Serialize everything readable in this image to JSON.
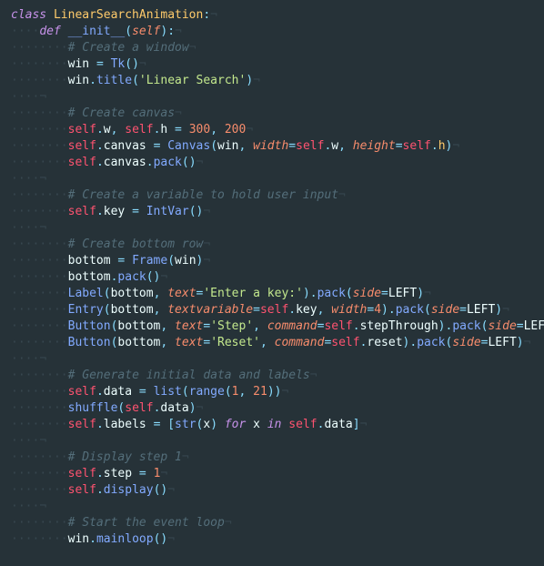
{
  "ws4": "····",
  "ws8": "········",
  "eol": "¬",
  "lines": [
    {
      "t": [
        [
          "kw",
          "class"
        ],
        [
          "id",
          " "
        ],
        [
          "cl",
          "LinearSearchAnimation"
        ],
        [
          "p",
          ":"
        ]
      ]
    },
    {
      "i": 1,
      "t": [
        [
          "kw",
          "def"
        ],
        [
          "id",
          " "
        ],
        [
          "fn",
          "__init__"
        ],
        [
          "p",
          "("
        ],
        [
          "pn",
          "self"
        ],
        [
          "p",
          ")"
        ],
        [
          "p",
          ":"
        ]
      ]
    },
    {
      "i": 2,
      "t": [
        [
          "c",
          "# Create a window"
        ]
      ]
    },
    {
      "i": 2,
      "t": [
        [
          "id",
          "win "
        ],
        [
          "o",
          "="
        ],
        [
          "id",
          " "
        ],
        [
          "pr",
          "Tk"
        ],
        [
          "p",
          "()"
        ]
      ]
    },
    {
      "i": 2,
      "t": [
        [
          "id",
          "win"
        ],
        [
          "p",
          "."
        ],
        [
          "fn",
          "title"
        ],
        [
          "p",
          "("
        ],
        [
          "s",
          "'Linear Search'"
        ],
        [
          "p",
          ")"
        ]
      ]
    },
    {
      "blank": 1
    },
    {
      "i": 2,
      "t": [
        [
          "c",
          "# Create canvas"
        ]
      ]
    },
    {
      "i": 2,
      "t": [
        [
          "sf",
          "self"
        ],
        [
          "p",
          "."
        ],
        [
          "id",
          "w"
        ],
        [
          "p",
          ","
        ],
        [
          "id",
          " "
        ],
        [
          "sf",
          "self"
        ],
        [
          "p",
          "."
        ],
        [
          "id",
          "h "
        ],
        [
          "o",
          "="
        ],
        [
          "id",
          " "
        ],
        [
          "n",
          "300"
        ],
        [
          "p",
          ","
        ],
        [
          "id",
          " "
        ],
        [
          "n",
          "200"
        ]
      ]
    },
    {
      "i": 2,
      "t": [
        [
          "sf",
          "self"
        ],
        [
          "p",
          "."
        ],
        [
          "id",
          "canvas "
        ],
        [
          "o",
          "="
        ],
        [
          "id",
          " "
        ],
        [
          "pr",
          "Canvas"
        ],
        [
          "p",
          "("
        ],
        [
          "id",
          "win"
        ],
        [
          "p",
          ","
        ],
        [
          "id",
          " "
        ],
        [
          "pn",
          "width"
        ],
        [
          "o",
          "="
        ],
        [
          "sf",
          "self"
        ],
        [
          "p",
          "."
        ],
        [
          "id",
          "w"
        ],
        [
          "p",
          ","
        ],
        [
          "id",
          " "
        ],
        [
          "pn",
          "height"
        ],
        [
          "o",
          "="
        ],
        [
          "sf",
          "self"
        ],
        [
          "p",
          "."
        ],
        [
          "mf",
          "h"
        ],
        [
          "p",
          ")"
        ]
      ]
    },
    {
      "i": 2,
      "t": [
        [
          "sf",
          "self"
        ],
        [
          "p",
          "."
        ],
        [
          "id",
          "canvas"
        ],
        [
          "p",
          "."
        ],
        [
          "fn",
          "pack"
        ],
        [
          "p",
          "()"
        ]
      ]
    },
    {
      "blank": 1
    },
    {
      "i": 2,
      "t": [
        [
          "c",
          "# Create a variable to hold user input"
        ]
      ]
    },
    {
      "i": 2,
      "t": [
        [
          "sf",
          "self"
        ],
        [
          "p",
          "."
        ],
        [
          "id",
          "key "
        ],
        [
          "o",
          "="
        ],
        [
          "id",
          " "
        ],
        [
          "pr",
          "IntVar"
        ],
        [
          "p",
          "()"
        ]
      ]
    },
    {
      "blank": 1
    },
    {
      "i": 2,
      "t": [
        [
          "c",
          "# Create bottom row"
        ]
      ]
    },
    {
      "i": 2,
      "t": [
        [
          "id",
          "bottom "
        ],
        [
          "o",
          "="
        ],
        [
          "id",
          " "
        ],
        [
          "pr",
          "Frame"
        ],
        [
          "p",
          "("
        ],
        [
          "id",
          "win"
        ],
        [
          "p",
          ")"
        ]
      ]
    },
    {
      "i": 2,
      "t": [
        [
          "id",
          "bottom"
        ],
        [
          "p",
          "."
        ],
        [
          "fn",
          "pack"
        ],
        [
          "p",
          "()"
        ]
      ]
    },
    {
      "i": 2,
      "t": [
        [
          "pr",
          "Label"
        ],
        [
          "p",
          "("
        ],
        [
          "id",
          "bottom"
        ],
        [
          "p",
          ","
        ],
        [
          "id",
          " "
        ],
        [
          "pn",
          "text"
        ],
        [
          "o",
          "="
        ],
        [
          "s",
          "'Enter a key:'"
        ],
        [
          "p",
          ")."
        ],
        [
          "fn",
          "pack"
        ],
        [
          "p",
          "("
        ],
        [
          "pn",
          "side"
        ],
        [
          "o",
          "="
        ],
        [
          "id",
          "LEFT"
        ],
        [
          "p",
          ")"
        ]
      ]
    },
    {
      "i": 2,
      "t": [
        [
          "pr",
          "Entry"
        ],
        [
          "p",
          "("
        ],
        [
          "id",
          "bottom"
        ],
        [
          "p",
          ","
        ],
        [
          "id",
          " "
        ],
        [
          "pn",
          "textvariable"
        ],
        [
          "o",
          "="
        ],
        [
          "sf",
          "self"
        ],
        [
          "p",
          "."
        ],
        [
          "id",
          "key"
        ],
        [
          "p",
          ","
        ],
        [
          "id",
          " "
        ],
        [
          "pn",
          "width"
        ],
        [
          "o",
          "="
        ],
        [
          "n",
          "4"
        ],
        [
          "p",
          ")."
        ],
        [
          "fn",
          "pack"
        ],
        [
          "p",
          "("
        ],
        [
          "pn",
          "side"
        ],
        [
          "o",
          "="
        ],
        [
          "id",
          "LEFT"
        ],
        [
          "p",
          ")"
        ]
      ]
    },
    {
      "i": 2,
      "t": [
        [
          "pr",
          "Button"
        ],
        [
          "p",
          "("
        ],
        [
          "id",
          "bottom"
        ],
        [
          "p",
          ","
        ],
        [
          "id",
          " "
        ],
        [
          "pn",
          "text"
        ],
        [
          "o",
          "="
        ],
        [
          "s",
          "'Step'"
        ],
        [
          "p",
          ","
        ],
        [
          "id",
          " "
        ],
        [
          "pn",
          "command"
        ],
        [
          "o",
          "="
        ],
        [
          "sf",
          "self"
        ],
        [
          "p",
          "."
        ],
        [
          "id",
          "stepThrough"
        ],
        [
          "p",
          ")."
        ],
        [
          "fn",
          "pack"
        ],
        [
          "p",
          "("
        ],
        [
          "pn",
          "side"
        ],
        [
          "o",
          "="
        ],
        [
          "id",
          "LEFT"
        ],
        [
          "p",
          ")"
        ]
      ]
    },
    {
      "i": 2,
      "t": [
        [
          "pr",
          "Button"
        ],
        [
          "p",
          "("
        ],
        [
          "id",
          "bottom"
        ],
        [
          "p",
          ","
        ],
        [
          "id",
          " "
        ],
        [
          "pn",
          "text"
        ],
        [
          "o",
          "="
        ],
        [
          "s",
          "'Reset'"
        ],
        [
          "p",
          ","
        ],
        [
          "id",
          " "
        ],
        [
          "pn",
          "command"
        ],
        [
          "o",
          "="
        ],
        [
          "sf",
          "self"
        ],
        [
          "p",
          "."
        ],
        [
          "id",
          "reset"
        ],
        [
          "p",
          ")."
        ],
        [
          "fn",
          "pack"
        ],
        [
          "p",
          "("
        ],
        [
          "pn",
          "side"
        ],
        [
          "o",
          "="
        ],
        [
          "id",
          "LEFT"
        ],
        [
          "p",
          ")"
        ]
      ]
    },
    {
      "blank": 1
    },
    {
      "i": 2,
      "t": [
        [
          "c",
          "# Generate initial data and labels"
        ]
      ]
    },
    {
      "i": 2,
      "t": [
        [
          "sf",
          "self"
        ],
        [
          "p",
          "."
        ],
        [
          "id",
          "data "
        ],
        [
          "o",
          "="
        ],
        [
          "id",
          " "
        ],
        [
          "fn",
          "list"
        ],
        [
          "p",
          "("
        ],
        [
          "fn",
          "range"
        ],
        [
          "p",
          "("
        ],
        [
          "n",
          "1"
        ],
        [
          "p",
          ","
        ],
        [
          "id",
          " "
        ],
        [
          "n",
          "21"
        ],
        [
          "p",
          "))"
        ]
      ]
    },
    {
      "i": 2,
      "t": [
        [
          "fn",
          "shuffle"
        ],
        [
          "p",
          "("
        ],
        [
          "sf",
          "self"
        ],
        [
          "p",
          "."
        ],
        [
          "id",
          "data"
        ],
        [
          "p",
          ")"
        ]
      ]
    },
    {
      "i": 2,
      "t": [
        [
          "sf",
          "self"
        ],
        [
          "p",
          "."
        ],
        [
          "id",
          "labels "
        ],
        [
          "o",
          "="
        ],
        [
          "id",
          " "
        ],
        [
          "p",
          "["
        ],
        [
          "fn",
          "str"
        ],
        [
          "p",
          "("
        ],
        [
          "id",
          "x"
        ],
        [
          "p",
          ")"
        ],
        [
          "id",
          " "
        ],
        [
          "kw",
          "for"
        ],
        [
          "id",
          " x "
        ],
        [
          "kw",
          "in"
        ],
        [
          "id",
          " "
        ],
        [
          "sf",
          "self"
        ],
        [
          "p",
          "."
        ],
        [
          "id",
          "data"
        ],
        [
          "p",
          "]"
        ]
      ]
    },
    {
      "blank": 1
    },
    {
      "i": 2,
      "t": [
        [
          "c",
          "# Display step 1"
        ]
      ]
    },
    {
      "i": 2,
      "t": [
        [
          "sf",
          "self"
        ],
        [
          "p",
          "."
        ],
        [
          "id",
          "step "
        ],
        [
          "o",
          "="
        ],
        [
          "id",
          " "
        ],
        [
          "n",
          "1"
        ]
      ]
    },
    {
      "i": 2,
      "t": [
        [
          "sf",
          "self"
        ],
        [
          "p",
          "."
        ],
        [
          "fn",
          "display"
        ],
        [
          "p",
          "()"
        ]
      ]
    },
    {
      "blank": 1
    },
    {
      "i": 2,
      "t": [
        [
          "c",
          "# Start the event loop"
        ]
      ]
    },
    {
      "i": 2,
      "t": [
        [
          "id",
          "win"
        ],
        [
          "p",
          "."
        ],
        [
          "fn",
          "mainloop"
        ],
        [
          "p",
          "()"
        ]
      ]
    }
  ]
}
